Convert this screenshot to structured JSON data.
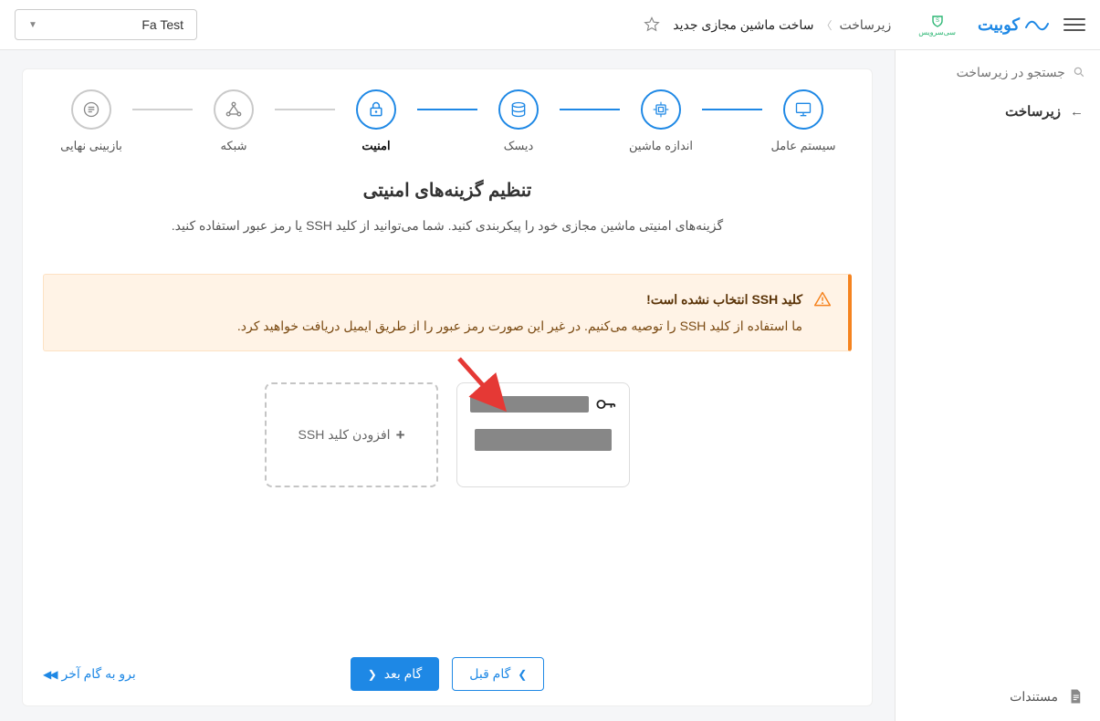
{
  "brand": {
    "name": "کوبیت"
  },
  "breadcrumb": {
    "root": "زیرساخت",
    "current": "ساخت ماشین مجازی جدید"
  },
  "project_selector": {
    "value": "Fa Test"
  },
  "sidebar": {
    "search_placeholder": "جستجو در زیرساخت",
    "nav_infra": "زیرساخت",
    "docs": "مستندات"
  },
  "stepper": {
    "os": "سیستم عامل",
    "size": "اندازه ماشین",
    "disk": "دیسک",
    "security": "امنیت",
    "network": "شبکه",
    "review": "بازبینی نهایی"
  },
  "security": {
    "title": "تنظیم گزینه‌های امنیتی",
    "description": "گزینه‌های امنیتی ماشین مجازی خود را پیکربندی کنید. شما می‌توانید از کلید SSH یا رمز عبور استفاده کنید."
  },
  "alert": {
    "title": "کلید SSH انتخاب نشده است!",
    "body": "ما استفاده از کلید SSH را توصیه می‌کنیم. در غیر این صورت رمز عبور را از طریق ایمیل دریافت خواهید کرد."
  },
  "keys": {
    "add_label": "افزودن کلید SSH"
  },
  "footer": {
    "prev": "گام قبل",
    "next": "گام بعد",
    "go_last": "برو به گام آخر"
  }
}
